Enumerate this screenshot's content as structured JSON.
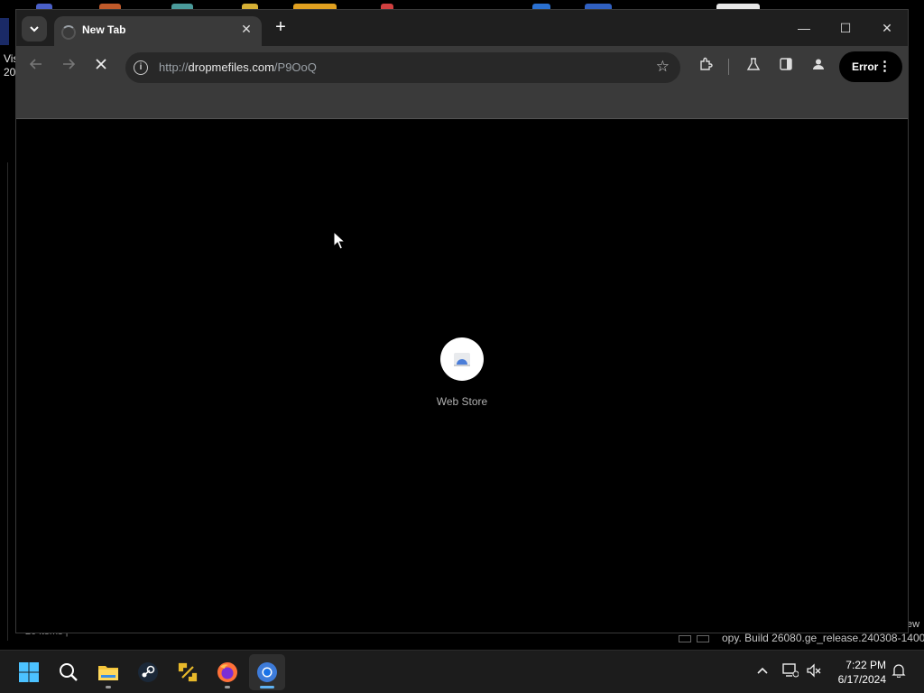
{
  "browser": {
    "tab_title": "New Tab",
    "tab_close_glyph": "✕",
    "new_tab_glyph": "+",
    "url_scheme": "http://",
    "url_host": "dropmefiles.com",
    "url_path": "/P9OoQ",
    "profile_status": "Error",
    "window_controls": {
      "minimize": "—",
      "maximize": "☐",
      "close": "✕"
    }
  },
  "content": {
    "shortcut_label": "Web Store"
  },
  "desktop": {
    "left_text_line1": "Vis",
    "left_text_line2": "20",
    "footer_left": "20 items |",
    "footer_right": "opy. Build 26080.ge_release.240308-1400",
    "footer_ew": "ew"
  },
  "taskbar": {
    "apps": [
      "start-icon",
      "search-icon",
      "file-explorer-icon",
      "steam-icon",
      "tools-icon",
      "firefox-icon",
      "chrome-icon"
    ],
    "time": "7:22 PM",
    "date": "6/17/2024"
  },
  "colors": {
    "accent": "#5fb2f2",
    "tab_active": "#3a3a3a",
    "toolbar": "#3a3a3a",
    "tabstrip": "#1f1f1f"
  }
}
